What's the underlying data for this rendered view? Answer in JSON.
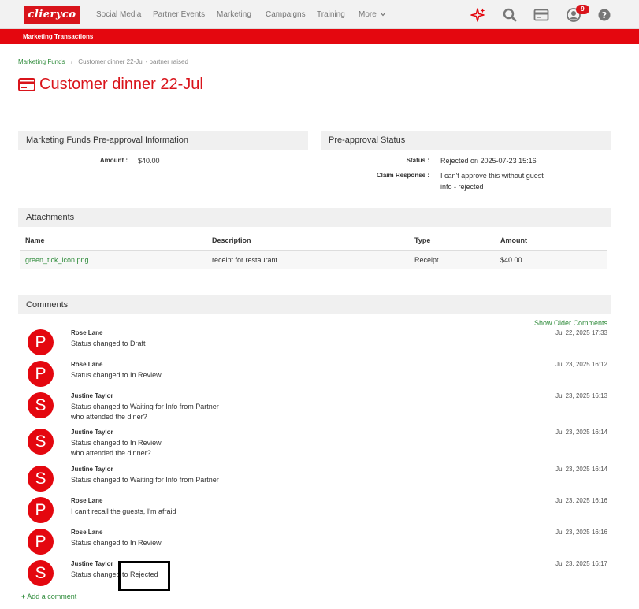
{
  "brand": {
    "logo": "clieryco"
  },
  "nav": [
    {
      "label": "Social Media"
    },
    {
      "label": "Partner Events"
    },
    {
      "label": "Marketing"
    },
    {
      "label": "Campaigns"
    },
    {
      "label": "Training"
    },
    {
      "label": "More"
    }
  ],
  "notifications": {
    "count": "9"
  },
  "subnav": {
    "label": "Marketing Transactions"
  },
  "breadcrumb": {
    "root": "Marketing Funds",
    "sep": "/",
    "current": "Customer dinner 22-Jul - partner raised"
  },
  "page": {
    "title": "Customer dinner 22-Jul"
  },
  "preapproval_info": {
    "heading": "Marketing Funds Pre-approval Information",
    "amount_label": "Amount :",
    "amount_value": "$40.00"
  },
  "preapproval_status": {
    "heading": "Pre-approval Status",
    "status_label": "Status :",
    "status_value": "Rejected on 2025-07-23 15:16",
    "response_label": "Claim Response :",
    "response_line1": "I can't approve this without guest",
    "response_line2": "info - rejected"
  },
  "attachments": {
    "heading": "Attachments",
    "columns": {
      "name": "Name",
      "description": "Description",
      "type": "Type",
      "amount": "Amount"
    },
    "rows": [
      {
        "name": "green_tick_icon.png",
        "description": "receipt for restaurant",
        "type": "Receipt",
        "amount": "$40.00"
      }
    ]
  },
  "comments": {
    "heading": "Comments",
    "show_older": "Show Older Comments",
    "add": "Add a comment",
    "items": [
      {
        "initial": "P",
        "author": "Rose Lane",
        "line1": "Status changed to Draft",
        "line2": "",
        "time": "Jul 22, 2025 17:33"
      },
      {
        "initial": "P",
        "author": "Rose Lane",
        "line1": "Status changed to In Review",
        "line2": "",
        "time": "Jul 23, 2025 16:12"
      },
      {
        "initial": "S",
        "author": "Justine Taylor",
        "line1": "Status changed to Waiting for Info from Partner",
        "line2": "who attended the diner?",
        "time": "Jul 23, 2025 16:13"
      },
      {
        "initial": "S",
        "author": "Justine Taylor",
        "line1": "Status changed to In Review",
        "line2": "who attended the dinner?",
        "time": "Jul 23, 2025 16:14"
      },
      {
        "initial": "S",
        "author": "Justine Taylor",
        "line1": "Status changed to Waiting for Info from Partner",
        "line2": "",
        "time": "Jul 23, 2025 16:14"
      },
      {
        "initial": "P",
        "author": "Rose Lane",
        "line1": "I can't recall the guests, I'm afraid",
        "line2": "",
        "time": "Jul 23, 2025 16:16"
      },
      {
        "initial": "P",
        "author": "Rose Lane",
        "line1": "Status changed to In Review",
        "line2": "",
        "time": "Jul 23, 2025 16:16"
      },
      {
        "initial": "S",
        "author": "Justine Taylor",
        "line1": "Status changed to Rejected",
        "line2": "",
        "time": "Jul 23, 2025 16:17"
      }
    ]
  },
  "colors": {
    "brand_red": "#e4070f",
    "link_green": "#2e8b3a",
    "panel_grey": "#f0f0f0"
  },
  "icons": [
    "sparkle-icon",
    "search-icon",
    "card-icon",
    "user-icon",
    "help-icon",
    "credit-card-icon",
    "chevron-down-icon",
    "plus-icon"
  ]
}
